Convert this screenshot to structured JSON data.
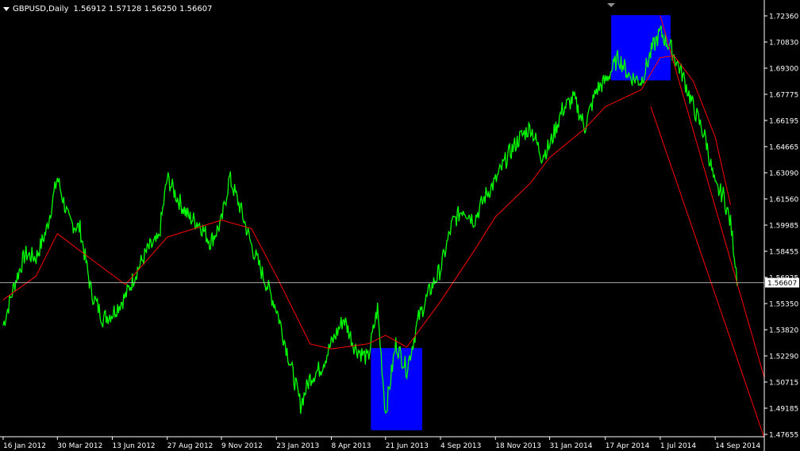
{
  "header": {
    "symbol": "GBPUSD,Daily",
    "ohlc": "1.56912 1.57128 1.56250 1.56607"
  },
  "colors": {
    "background": "#000000",
    "price": "#00ff00",
    "moving_average": "#ff0000",
    "trendlines": "#ff0000",
    "highlight_boxes": "#0000ff",
    "axis": "#ffffff",
    "current_price_line": "#c0c0c0"
  },
  "chart_data": {
    "type": "line",
    "xlabel": "",
    "ylabel": "",
    "x_ticks": [
      "16 Jan 2012",
      "30 Mar 2012",
      "13 Jun 2012",
      "27 Aug 2012",
      "9 Nov 2012",
      "23 Jan 2013",
      "8 Apr 2013",
      "21 Jun 2013",
      "4 Sep 2013",
      "18 Nov 2013",
      "31 Jan 2014",
      "17 Apr 2014",
      "1 Jul 2014",
      "14 Sep 2014"
    ],
    "y_ticks": [
      "1.72360",
      "1.70830",
      "1.69300",
      "1.67775",
      "1.66195",
      "1.64665",
      "1.63090",
      "1.61560",
      "1.59985",
      "1.58455",
      "1.56925",
      "1.55350",
      "1.53820",
      "1.52290",
      "1.50715",
      "1.49185",
      "1.47655"
    ],
    "ylim": [
      1.47655,
      1.7236
    ],
    "current_price": "1.56607",
    "series": [
      {
        "values_x": [
          "2012-01-16",
          "2012-02-01",
          "2012-02-15",
          "2012-03-01",
          "2012-03-15",
          "2012-03-30",
          "2012-04-15",
          "2012-04-30",
          "2012-05-15",
          "2012-05-31",
          "2012-06-13",
          "2012-07-01",
          "2012-07-15",
          "2012-08-01",
          "2012-08-15",
          "2012-08-27",
          "2012-09-10",
          "2012-09-25",
          "2012-10-10",
          "2012-10-25",
          "2012-11-09",
          "2012-11-20",
          "2012-12-05",
          "2012-12-20",
          "2013-01-05",
          "2013-01-23",
          "2013-02-10",
          "2013-02-25",
          "2013-03-10",
          "2013-03-25",
          "2013-04-08",
          "2013-04-25",
          "2013-05-10",
          "2013-05-28",
          "2013-06-10",
          "2013-06-21",
          "2013-07-05",
          "2013-07-20",
          "2013-08-05",
          "2013-08-20",
          "2013-09-04",
          "2013-09-20",
          "2013-10-05",
          "2013-10-20",
          "2013-11-05",
          "2013-11-18",
          "2013-12-05",
          "2013-12-20",
          "2014-01-05",
          "2014-01-20",
          "2014-01-31",
          "2014-02-17",
          "2014-03-05",
          "2014-03-20",
          "2014-04-05",
          "2014-04-17",
          "2014-05-05",
          "2014-05-20",
          "2014-06-05",
          "2014-06-20",
          "2014-07-01",
          "2014-07-15",
          "2014-08-01",
          "2014-08-15",
          "2014-09-01",
          "2014-09-14",
          "2014-09-25",
          "2014-10-05",
          "2014-10-15"
        ],
        "values": [
          1.541,
          1.566,
          1.583,
          1.581,
          1.597,
          1.628,
          1.602,
          1.598,
          1.561,
          1.545,
          1.548,
          1.558,
          1.572,
          1.586,
          1.591,
          1.628,
          1.616,
          1.605,
          1.601,
          1.59,
          1.602,
          1.628,
          1.61,
          1.588,
          1.57,
          1.551,
          1.52,
          1.494,
          1.51,
          1.516,
          1.53,
          1.545,
          1.528,
          1.521,
          1.551,
          1.489,
          1.53,
          1.515,
          1.545,
          1.561,
          1.574,
          1.601,
          1.61,
          1.603,
          1.618,
          1.626,
          1.641,
          1.651,
          1.658,
          1.641,
          1.647,
          1.668,
          1.675,
          1.658,
          1.68,
          1.685,
          1.699,
          1.688,
          1.685,
          1.704,
          1.714,
          1.705,
          1.688,
          1.67,
          1.651,
          1.622,
          1.618,
          1.601,
          1.566
        ]
      },
      {
        "values_x": [
          "2012-01-16",
          "2012-03-01",
          "2012-03-30",
          "2012-05-15",
          "2012-07-01",
          "2012-08-27",
          "2012-11-09",
          "2012-12-20",
          "2013-01-23",
          "2013-03-10",
          "2013-04-08",
          "2013-05-28",
          "2013-06-21",
          "2013-07-20",
          "2013-09-04",
          "2013-10-20",
          "2013-11-18",
          "2014-01-05",
          "2014-01-31",
          "2014-03-20",
          "2014-04-17",
          "2014-06-05",
          "2014-07-01",
          "2014-07-20",
          "2014-08-15",
          "2014-09-14",
          "2014-10-05"
        ],
        "values": [
          1.556,
          1.57,
          1.595,
          1.58,
          1.565,
          1.593,
          1.603,
          1.598,
          1.57,
          1.53,
          1.527,
          1.53,
          1.535,
          1.528,
          1.555,
          1.585,
          1.605,
          1.625,
          1.64,
          1.657,
          1.67,
          1.68,
          1.699,
          1.7,
          1.685,
          1.652,
          1.612
        ]
      }
    ],
    "trendlines": [
      {
        "from": [
          "2014-07-01",
          1.7236
        ],
        "to": [
          "2014-11-20",
          1.51
        ]
      },
      {
        "from": [
          "2014-06-18",
          1.67
        ],
        "to": [
          "2014-11-20",
          1.4745
        ]
      }
    ],
    "highlights": [
      {
        "x_from": "2013-06-01",
        "x_to": "2013-08-10",
        "y_from": 1.479,
        "y_to": 1.5275
      },
      {
        "x_from": "2014-04-25",
        "x_to": "2014-07-15",
        "y_from": 1.6855,
        "y_to": 1.724
      }
    ]
  }
}
